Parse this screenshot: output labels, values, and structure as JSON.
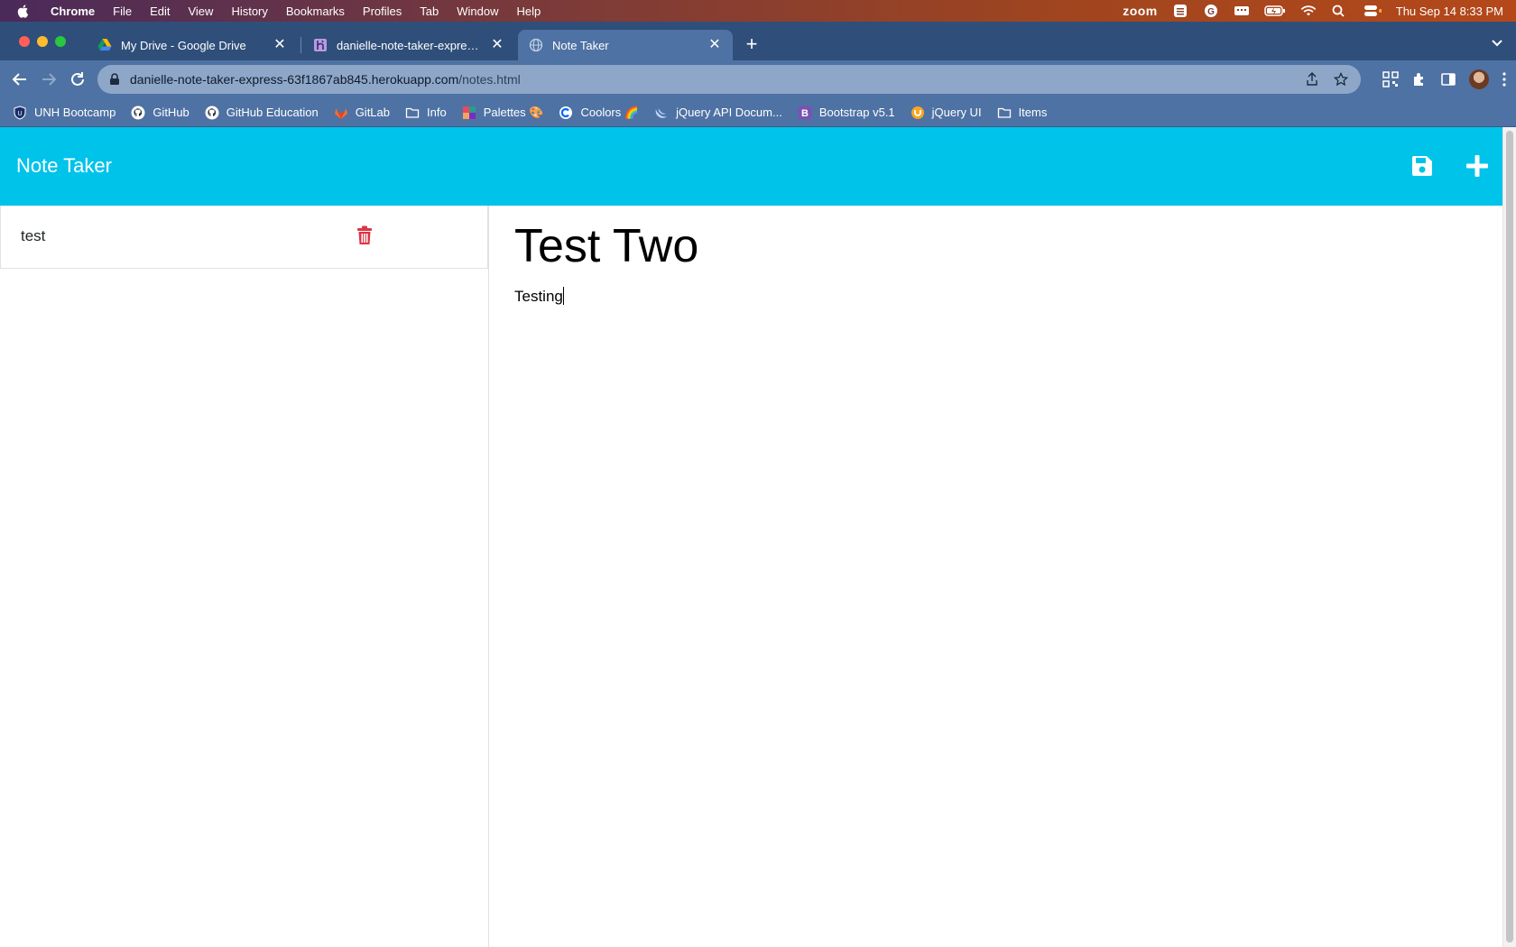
{
  "menubar": {
    "app": "Chrome",
    "items": [
      "File",
      "Edit",
      "View",
      "History",
      "Bookmarks",
      "Profiles",
      "Tab",
      "Window",
      "Help"
    ],
    "zoom_label": "zoom",
    "datetime": "Thu Sep 14  8:33 PM"
  },
  "tabs": [
    {
      "title": "My Drive - Google Drive",
      "icon": "google-drive-icon"
    },
    {
      "title": "danielle-note-taker-express · A",
      "icon": "heroku-icon"
    },
    {
      "title": "Note Taker",
      "icon": "globe-icon",
      "active": true
    }
  ],
  "omnibox": {
    "host": "danielle-note-taker-express-63f1867ab845.herokuapp.com",
    "path": "/notes.html"
  },
  "bookmarks": [
    {
      "label": "UNH Bootcamp",
      "icon": "shield-icon"
    },
    {
      "label": "GitHub",
      "icon": "github-icon"
    },
    {
      "label": "GitHub Education",
      "icon": "github-icon"
    },
    {
      "label": "GitLab",
      "icon": "gitlab-icon"
    },
    {
      "label": "Info",
      "icon": "folder-icon"
    },
    {
      "label": "Palettes 🎨",
      "icon": "palette-icon"
    },
    {
      "label": "Coolors 🌈",
      "icon": "coolors-icon"
    },
    {
      "label": "jQuery API Docum...",
      "icon": "jquery-icon"
    },
    {
      "label": "Bootstrap v5.1",
      "icon": "bootstrap-icon"
    },
    {
      "label": "jQuery UI",
      "icon": "jquery-ui-icon"
    },
    {
      "label": "Items",
      "icon": "folder-icon"
    }
  ],
  "app": {
    "brand": "Note Taker",
    "accent_color": "#00c3ea",
    "delete_color": "#dc3545",
    "notes": [
      {
        "title": "test"
      }
    ],
    "active_note": {
      "title": "Test Two",
      "text": "Testing"
    }
  }
}
